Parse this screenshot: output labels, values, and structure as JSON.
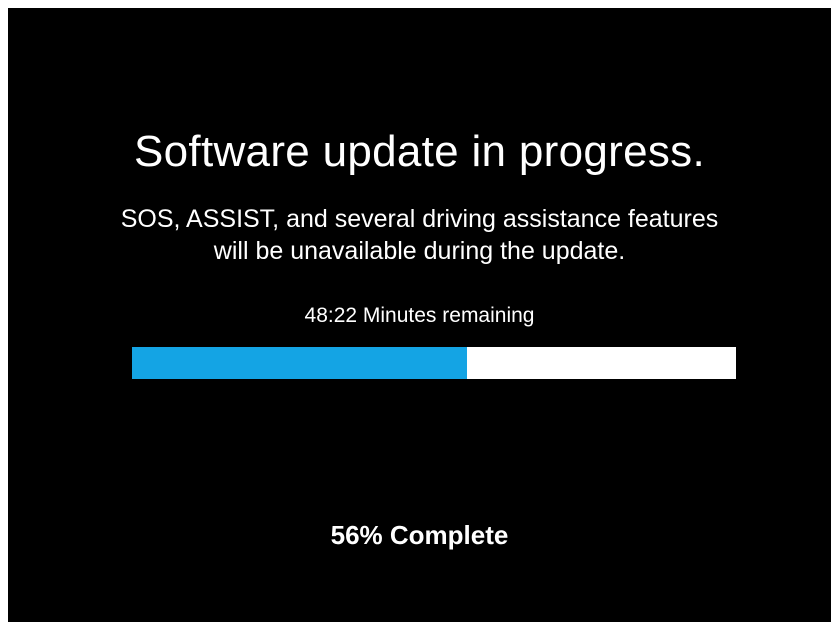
{
  "update": {
    "title": "Software update in progress.",
    "message_line1": "SOS, ASSIST, and several driving assistance features",
    "message_line2": "will be unavailable during the update.",
    "time_remaining": "48:22 Minutes remaining",
    "progress_fraction": 0.555,
    "percent_label": "56% Complete"
  },
  "colors": {
    "background": "#000000",
    "text": "#ffffff",
    "progress_fill": "#14a4e4",
    "progress_track": "#ffffff"
  }
}
